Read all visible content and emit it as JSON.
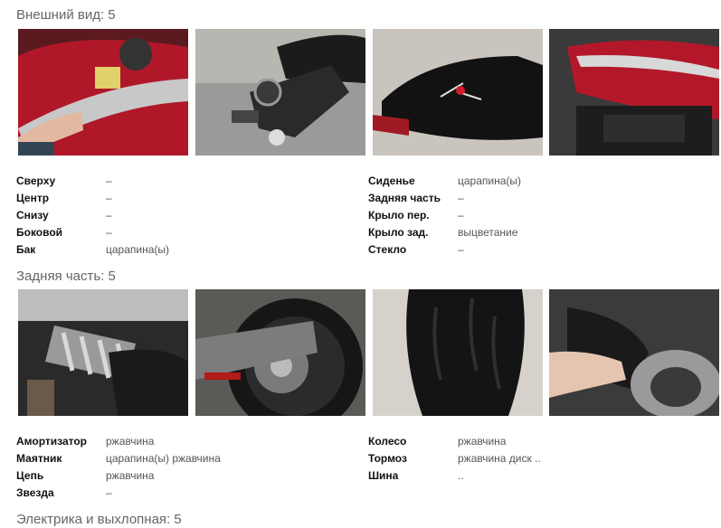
{
  "sections": [
    {
      "title": "Внешний вид: 5",
      "left": [
        {
          "label": "Сверху",
          "value": "–"
        },
        {
          "label": "Центр",
          "value": "–"
        },
        {
          "label": "Снизу",
          "value": "–"
        },
        {
          "label": "Боковой",
          "value": "–"
        },
        {
          "label": "Бак",
          "value": "царапина(ы)"
        }
      ],
      "right": [
        {
          "label": "Сиденье",
          "value": "царапина(ы)"
        },
        {
          "label": "Задняя часть",
          "value": "–"
        },
        {
          "label": "Крыло пер.",
          "value": "–"
        },
        {
          "label": "Крыло зад.",
          "value": "выцветание"
        },
        {
          "label": "Стекло",
          "value": "–"
        }
      ]
    },
    {
      "title": "Задняя часть: 5",
      "left": [
        {
          "label": "Амортизатор",
          "value": "ржавчина"
        },
        {
          "label": "Маятник",
          "value": "царапина(ы) ржавчина"
        },
        {
          "label": "Цепь",
          "value": "ржавчина"
        },
        {
          "label": "Звезда",
          "value": "–"
        }
      ],
      "right": [
        {
          "label": "Колесо",
          "value": "ржавчина"
        },
        {
          "label": "Тормоз",
          "value": "ржавчина диск .."
        },
        {
          "label": "Шина",
          "value": ".."
        }
      ]
    },
    {
      "title": "Электрика и выхлопная: 5"
    }
  ],
  "photos": [
    {
      "icon": "fuel-tank-photo"
    },
    {
      "icon": "rear-tail-photo"
    },
    {
      "icon": "seat-photo"
    },
    {
      "icon": "tank-side-photo"
    },
    {
      "icon": "shock-absorber-photo"
    },
    {
      "icon": "rear-wheel-photo"
    },
    {
      "icon": "tire-photo"
    },
    {
      "icon": "exhaust-photo"
    }
  ]
}
